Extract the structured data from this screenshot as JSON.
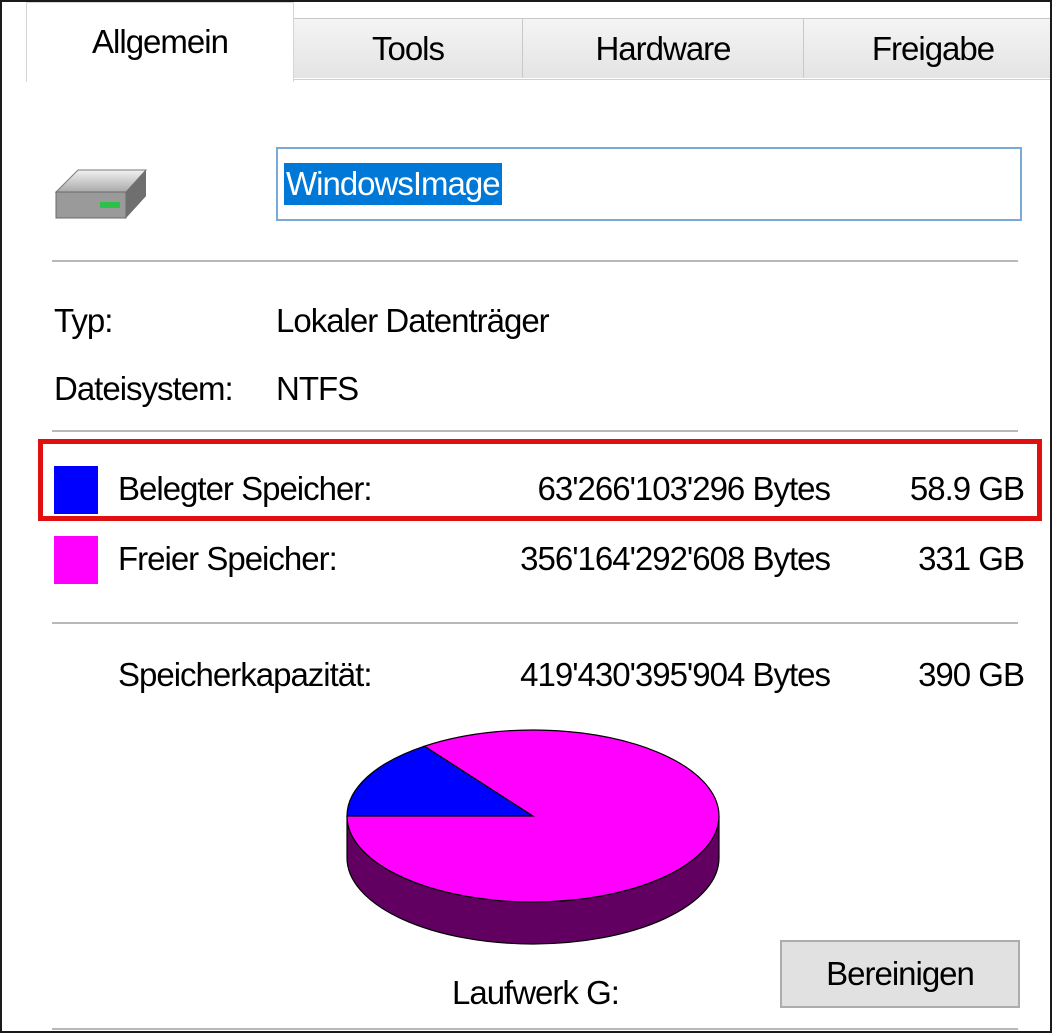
{
  "tabs": [
    {
      "label": "Allgemein",
      "active": true
    },
    {
      "label": "Tools",
      "active": false
    },
    {
      "label": "Hardware",
      "active": false
    },
    {
      "label": "Freigabe",
      "active": false
    }
  ],
  "drive": {
    "icon": "hard-drive-icon",
    "name_value": "WindowsImage"
  },
  "info": {
    "type_label": "Typ:",
    "type_value": "Lokaler Datenträger",
    "fs_label": "Dateisystem:",
    "fs_value": "NTFS"
  },
  "usage": {
    "used": {
      "label": "Belegter Speicher:",
      "bytes": "63'266'103'296 Bytes",
      "size": "58.9 GB",
      "color": "#0000ff"
    },
    "free": {
      "label": "Freier Speicher:",
      "bytes": "356'164'292'608 Bytes",
      "size": "331 GB",
      "color": "#ff00ff"
    },
    "capacity": {
      "label": "Speicherkapazität:",
      "bytes": "419'430'395'904 Bytes",
      "size": "390 GB"
    }
  },
  "chart_data": {
    "type": "pie",
    "categories": [
      "Belegter Speicher",
      "Freier Speicher"
    ],
    "values": [
      63266103296,
      356164292608
    ],
    "colors": [
      "#0000ff",
      "#ff00ff"
    ]
  },
  "footer": {
    "drive_label": "Laufwerk G:",
    "cleanup_button": "Bereinigen"
  }
}
